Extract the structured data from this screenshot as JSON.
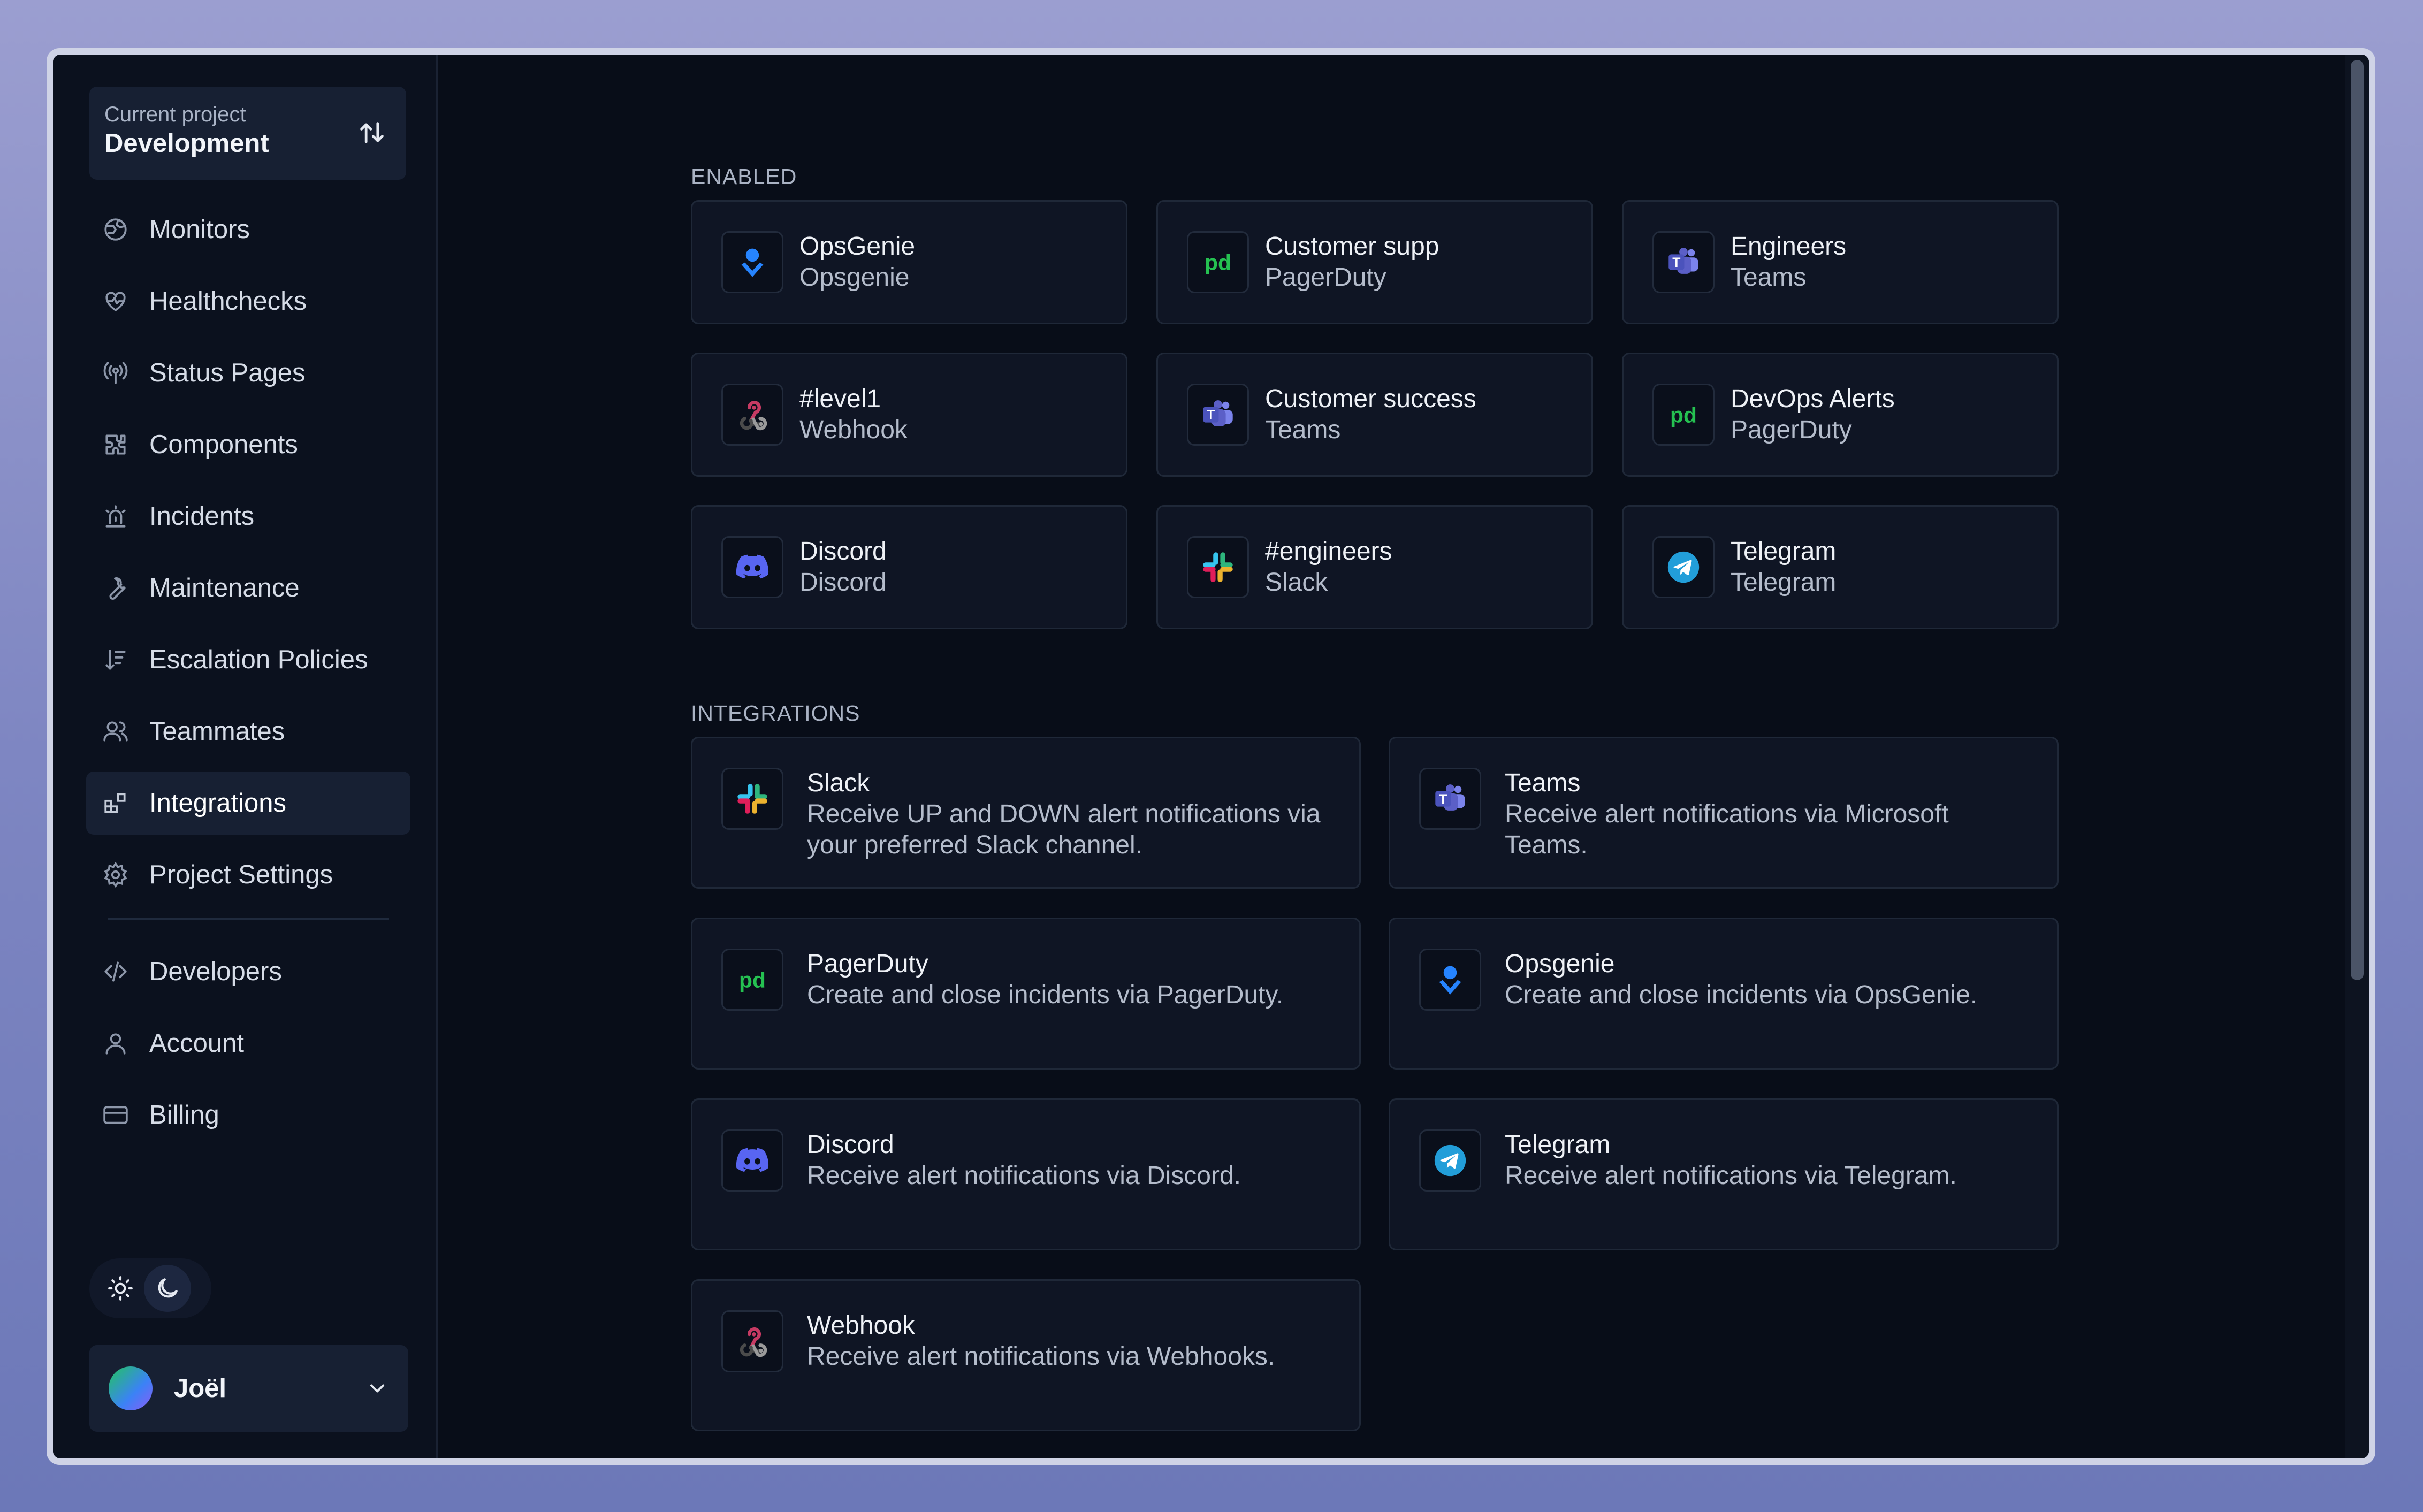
{
  "project": {
    "label": "Current project",
    "name": "Development"
  },
  "nav": {
    "items": [
      {
        "label": "Monitors"
      },
      {
        "label": "Healthchecks"
      },
      {
        "label": "Status Pages"
      },
      {
        "label": "Components"
      },
      {
        "label": "Incidents"
      },
      {
        "label": "Maintenance"
      },
      {
        "label": "Escalation Policies"
      },
      {
        "label": "Teammates"
      },
      {
        "label": "Integrations"
      },
      {
        "label": "Project Settings"
      }
    ],
    "secondary": [
      {
        "label": "Developers"
      },
      {
        "label": "Account"
      },
      {
        "label": "Billing"
      }
    ],
    "active": "Integrations"
  },
  "user": {
    "name": "Joël"
  },
  "sections": {
    "enabled": "ENABLED",
    "integrations": "INTEGRATIONS"
  },
  "enabled": [
    {
      "title": "OpsGenie",
      "type": "Opsgenie",
      "icon": "opsgenie-icon"
    },
    {
      "title": "Customer supp",
      "type": "PagerDuty",
      "icon": "pagerduty-icon"
    },
    {
      "title": "Engineers",
      "type": "Teams",
      "icon": "teams-icon"
    },
    {
      "title": "#level1",
      "type": "Webhook",
      "icon": "webhook-icon"
    },
    {
      "title": "Customer success",
      "type": "Teams",
      "icon": "teams-icon"
    },
    {
      "title": "DevOps Alerts",
      "type": "PagerDuty",
      "icon": "pagerduty-icon"
    },
    {
      "title": "Discord",
      "type": "Discord",
      "icon": "discord-icon"
    },
    {
      "title": "#engineers",
      "type": "Slack",
      "icon": "slack-icon"
    },
    {
      "title": "Telegram",
      "type": "Telegram",
      "icon": "telegram-icon"
    }
  ],
  "integrations": [
    {
      "title": "Slack",
      "desc": "Receive UP and DOWN alert notifications via your preferred Slack channel.",
      "icon": "slack-icon"
    },
    {
      "title": "Teams",
      "desc": "Receive alert notifications via Microsoft Teams.",
      "icon": "teams-icon"
    },
    {
      "title": "PagerDuty",
      "desc": "Create and close incidents via PagerDuty.",
      "icon": "pagerduty-icon"
    },
    {
      "title": "Opsgenie",
      "desc": "Create and close incidents via OpsGenie.",
      "icon": "opsgenie-icon"
    },
    {
      "title": "Discord",
      "desc": "Receive alert notifications via Discord.",
      "icon": "discord-icon"
    },
    {
      "title": "Telegram",
      "desc": "Receive alert notifications via Telegram.",
      "icon": "telegram-icon"
    },
    {
      "title": "Webhook",
      "desc": "Receive alert notifications via Webhooks.",
      "icon": "webhook-icon"
    }
  ],
  "colors": {
    "accent": "#3b2fa0",
    "pagerduty": "#25c151",
    "opsgenie": "#2684ff",
    "teams": "#5b5fc7",
    "discord": "#5865f2",
    "telegram": "#229ed9"
  }
}
